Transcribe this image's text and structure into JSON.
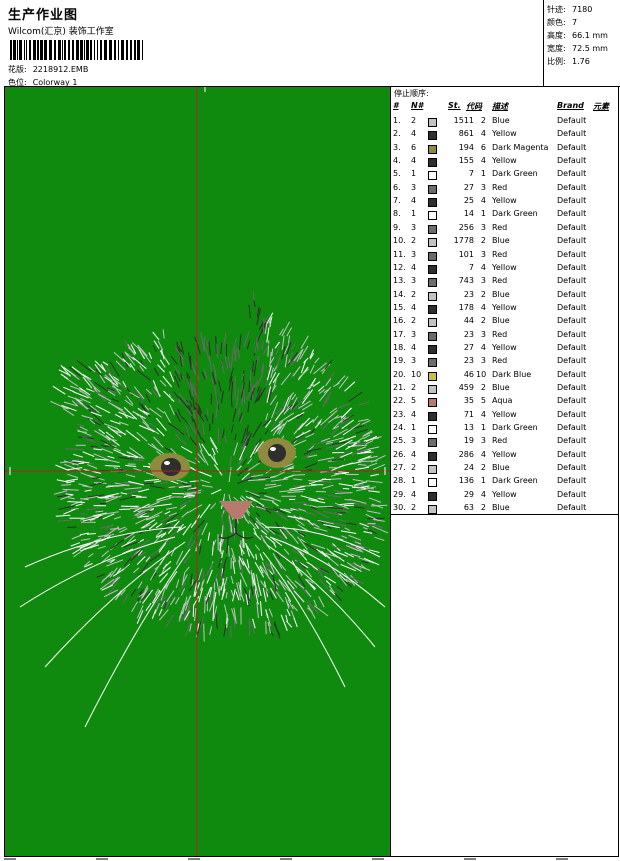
{
  "header": {
    "title": "生产作业图",
    "company": "Wilcom(汇京) 装饰工作室",
    "pattern_label": "花版:",
    "pattern_value": "2218912.EMB",
    "colorway_label": "色位:",
    "colorway_value": "Colorway 1"
  },
  "stats": [
    {
      "label": "针迹:",
      "value": "7180"
    },
    {
      "label": "颜色:",
      "value": "7"
    },
    {
      "label": "高度:",
      "value": "66.1 mm"
    },
    {
      "label": "宽度:",
      "value": "72.5 mm"
    },
    {
      "label": "比例:",
      "value": "1.76"
    }
  ],
  "color_list": {
    "title": "停止顺序:",
    "headers": {
      "num": "#",
      "needle": "N#",
      "stitches": "St.",
      "code": "代码",
      "description": "描述",
      "brand": "Brand",
      "element": "元素"
    },
    "rows": [
      {
        "num": "1.",
        "needle": "2",
        "color": "#c2c2c2",
        "stitches": "1511",
        "code": "2",
        "desc": "Blue",
        "brand": "Default"
      },
      {
        "num": "2.",
        "needle": "4",
        "color": "#2e2e2e",
        "stitches": "861",
        "code": "4",
        "desc": "Yellow",
        "brand": "Default"
      },
      {
        "num": "3.",
        "needle": "6",
        "color": "#8e8a3e",
        "stitches": "194",
        "code": "6",
        "desc": "Dark Magenta",
        "brand": "Default"
      },
      {
        "num": "4.",
        "needle": "4",
        "color": "#2e2e2e",
        "stitches": "155",
        "code": "4",
        "desc": "Yellow",
        "brand": "Default"
      },
      {
        "num": "5.",
        "needle": "1",
        "color": "#ffffff",
        "stitches": "7",
        "code": "1",
        "desc": "Dark Green",
        "brand": "Default"
      },
      {
        "num": "6.",
        "needle": "3",
        "color": "#6a6a6a",
        "stitches": "27",
        "code": "3",
        "desc": "Red",
        "brand": "Default"
      },
      {
        "num": "7.",
        "needle": "4",
        "color": "#2e2e2e",
        "stitches": "25",
        "code": "4",
        "desc": "Yellow",
        "brand": "Default"
      },
      {
        "num": "8.",
        "needle": "1",
        "color": "#ffffff",
        "stitches": "14",
        "code": "1",
        "desc": "Dark Green",
        "brand": "Default"
      },
      {
        "num": "9.",
        "needle": "3",
        "color": "#6a6a6a",
        "stitches": "256",
        "code": "3",
        "desc": "Red",
        "brand": "Default"
      },
      {
        "num": "10.",
        "needle": "2",
        "color": "#c2c2c2",
        "stitches": "1778",
        "code": "2",
        "desc": "Blue",
        "brand": "Default"
      },
      {
        "num": "11.",
        "needle": "3",
        "color": "#6a6a6a",
        "stitches": "101",
        "code": "3",
        "desc": "Red",
        "brand": "Default"
      },
      {
        "num": "12.",
        "needle": "4",
        "color": "#2e2e2e",
        "stitches": "7",
        "code": "4",
        "desc": "Yellow",
        "brand": "Default"
      },
      {
        "num": "13.",
        "needle": "3",
        "color": "#6a6a6a",
        "stitches": "743",
        "code": "3",
        "desc": "Red",
        "brand": "Default"
      },
      {
        "num": "14.",
        "needle": "2",
        "color": "#c2c2c2",
        "stitches": "23",
        "code": "2",
        "desc": "Blue",
        "brand": "Default"
      },
      {
        "num": "15.",
        "needle": "4",
        "color": "#2e2e2e",
        "stitches": "178",
        "code": "4",
        "desc": "Yellow",
        "brand": "Default"
      },
      {
        "num": "16.",
        "needle": "2",
        "color": "#c2c2c2",
        "stitches": "44",
        "code": "2",
        "desc": "Blue",
        "brand": "Default"
      },
      {
        "num": "17.",
        "needle": "3",
        "color": "#6a6a6a",
        "stitches": "23",
        "code": "3",
        "desc": "Red",
        "brand": "Default"
      },
      {
        "num": "18.",
        "needle": "4",
        "color": "#2e2e2e",
        "stitches": "27",
        "code": "4",
        "desc": "Yellow",
        "brand": "Default"
      },
      {
        "num": "19.",
        "needle": "3",
        "color": "#6a6a6a",
        "stitches": "23",
        "code": "3",
        "desc": "Red",
        "brand": "Default"
      },
      {
        "num": "20.",
        "needle": "10",
        "color": "#c8c040",
        "stitches": "46",
        "code": "10",
        "desc": "Dark Blue",
        "brand": "Default"
      },
      {
        "num": "21.",
        "needle": "2",
        "color": "#c2c2c2",
        "stitches": "459",
        "code": "2",
        "desc": "Blue",
        "brand": "Default"
      },
      {
        "num": "22.",
        "needle": "5",
        "color": "#b97a6e",
        "stitches": "35",
        "code": "5",
        "desc": "Aqua",
        "brand": "Default"
      },
      {
        "num": "23.",
        "needle": "4",
        "color": "#2e2e2e",
        "stitches": "71",
        "code": "4",
        "desc": "Yellow",
        "brand": "Default"
      },
      {
        "num": "24.",
        "needle": "1",
        "color": "#ffffff",
        "stitches": "13",
        "code": "1",
        "desc": "Dark Green",
        "brand": "Default"
      },
      {
        "num": "25.",
        "needle": "3",
        "color": "#6a6a6a",
        "stitches": "19",
        "code": "3",
        "desc": "Red",
        "brand": "Default"
      },
      {
        "num": "26.",
        "needle": "4",
        "color": "#2e2e2e",
        "stitches": "286",
        "code": "4",
        "desc": "Yellow",
        "brand": "Default"
      },
      {
        "num": "27.",
        "needle": "2",
        "color": "#c2c2c2",
        "stitches": "24",
        "code": "2",
        "desc": "Blue",
        "brand": "Default"
      },
      {
        "num": "28.",
        "needle": "1",
        "color": "#ffffff",
        "stitches": "136",
        "code": "1",
        "desc": "Dark Green",
        "brand": "Default"
      },
      {
        "num": "29.",
        "needle": "4",
        "color": "#2e2e2e",
        "stitches": "29",
        "code": "4",
        "desc": "Yellow",
        "brand": "Default"
      },
      {
        "num": "30.",
        "needle": "2",
        "color": "#c2c2c2",
        "stitches": "63",
        "code": "2",
        "desc": "Blue",
        "brand": "Default"
      }
    ]
  },
  "design": {
    "background_color": "#0f8a0f",
    "crosshair_color": "#b02020",
    "fur_colors": [
      "#c2c2c2",
      "#6a6a6a",
      "#2e2e2e",
      "#ffffff"
    ],
    "eye_color": "#8e8a3e",
    "nose_color": "#b97a6e"
  }
}
